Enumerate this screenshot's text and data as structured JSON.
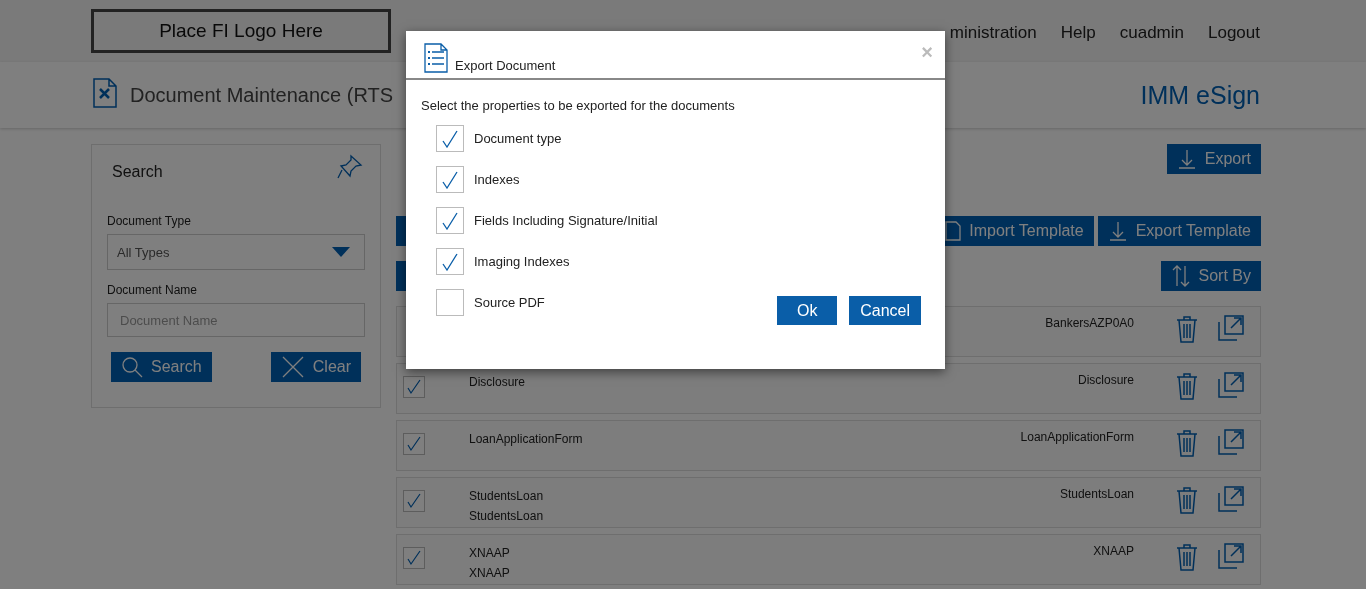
{
  "header": {
    "logo": "Place FI Logo Here",
    "nav": [
      "ministration",
      "Help",
      "cuadmin",
      "Logout"
    ]
  },
  "title_bar": {
    "title": "Document Maintenance (RTS",
    "brand": "IMM eSign"
  },
  "search": {
    "title": "Search",
    "document_type": {
      "label": "Document Type",
      "value": "All Types"
    },
    "document_name": {
      "label": "Document Name",
      "placeholder": "Document Name"
    },
    "buttons": [
      "Search",
      "Clear"
    ]
  },
  "toolbar": {
    "export": "Export",
    "import_template": "Import Template",
    "export_template": "Export Template",
    "sort": "Sort By"
  },
  "rows": [
    {
      "name_lines": [],
      "right": "BankersAZP0A0"
    },
    {
      "name_lines": [
        "Disclosure"
      ],
      "right": "Disclosure",
      "checked": true
    },
    {
      "name_lines": [
        "LoanApplicationForm"
      ],
      "right": "LoanApplicationForm",
      "checked": true
    },
    {
      "name_lines": [
        "StudentsLoan",
        "StudentsLoan"
      ],
      "right": "StudentsLoan",
      "checked": true
    },
    {
      "name_lines": [
        "XNAAP",
        "XNAAP"
      ],
      "right": "XNAAP",
      "checked": true
    }
  ],
  "dialog": {
    "title": "Export Document",
    "close": "×",
    "prompt": "Select the properties to be exported for the documents",
    "options": [
      {
        "label": "Document type",
        "checked": true
      },
      {
        "label": "Indexes",
        "checked": true
      },
      {
        "label": "Fields Including Signature/Initial",
        "checked": true
      },
      {
        "label": "Imaging Indexes",
        "checked": true
      },
      {
        "label": "Source PDF",
        "checked": false
      }
    ],
    "buttons": [
      "Ok",
      "Cancel"
    ]
  }
}
